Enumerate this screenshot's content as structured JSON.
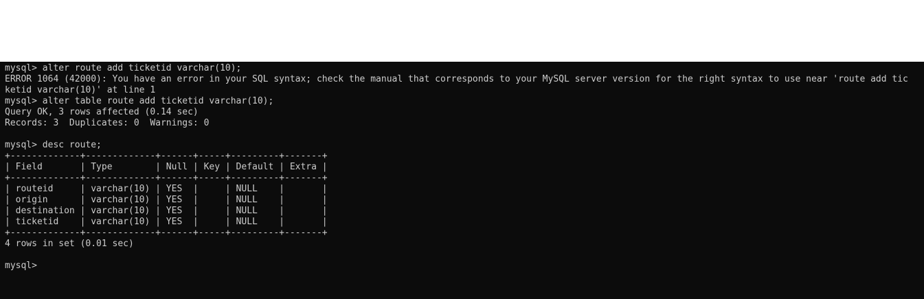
{
  "terminal": {
    "lines": [
      "mysql> alter route add ticketid varchar(10);",
      "ERROR 1064 (42000): You have an error in your SQL syntax; check the manual that corresponds to your MySQL server version for the right syntax to use near 'route add tic",
      "ketid varchar(10)' at line 1",
      "mysql> alter table route add ticketid varchar(10);",
      "Query OK, 3 rows affected (0.14 sec)",
      "Records: 3  Duplicates: 0  Warnings: 0",
      "",
      "mysql> desc route;",
      "+-------------+-------------+------+-----+---------+-------+",
      "| Field       | Type        | Null | Key | Default | Extra |",
      "+-------------+-------------+------+-----+---------+-------+",
      "| routeid     | varchar(10) | YES  |     | NULL    |       |",
      "| origin      | varchar(10) | YES  |     | NULL    |       |",
      "| destination | varchar(10) | YES  |     | NULL    |       |",
      "| ticketid    | varchar(10) | YES  |     | NULL    |       |",
      "+-------------+-------------+------+-----+---------+-------+",
      "4 rows in set (0.01 sec)",
      "",
      "mysql> "
    ]
  },
  "colors": {
    "background": "#0c0c0c",
    "text": "#cccccc"
  }
}
